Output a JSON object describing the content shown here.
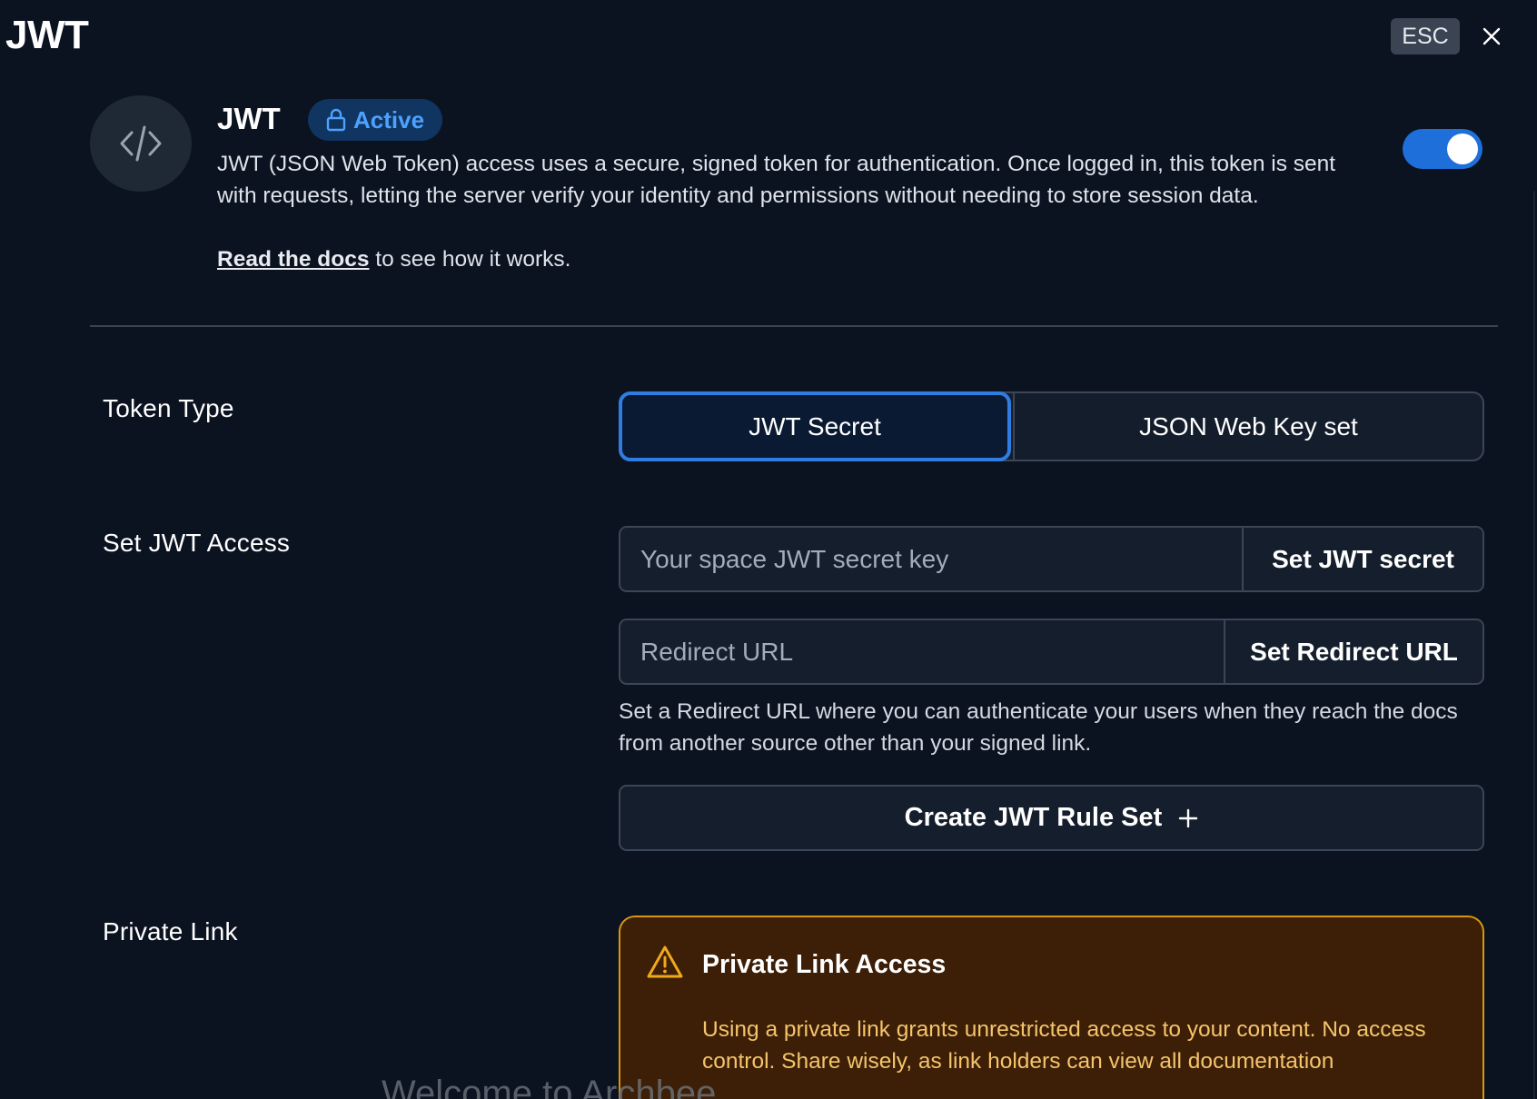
{
  "window": {
    "title": "JWT",
    "esc_label": "ESC"
  },
  "integration": {
    "name": "JWT",
    "status": "Active",
    "enabled": true,
    "description": "JWT (JSON Web Token) access uses a secure, signed token for authentication. Once logged in, this token is sent with requests, letting the server verify your identity and permissions without needing to store session data.",
    "docs_link": "Read the docs",
    "docs_suffix": " to see how it works.",
    "icon": "code-icon"
  },
  "token_type": {
    "label": "Token Type",
    "options": [
      "JWT Secret",
      "JSON Web Key set"
    ],
    "selected": "JWT Secret"
  },
  "jwt_access": {
    "label": "Set JWT Access",
    "secret_placeholder": "Your space JWT secret key",
    "secret_value": "",
    "secret_button": "Set JWT secret",
    "redirect_placeholder": "Redirect URL",
    "redirect_value": "",
    "redirect_button": "Set Redirect URL",
    "redirect_help": "Set a Redirect URL where you can authenticate your users when they reach the docs from another source other than your signed link.",
    "create_rule_button": "Create JWT Rule Set"
  },
  "private_link": {
    "label": "Private Link",
    "warning_title": "Private Link Access",
    "warning_body": "Using a private link grants unrestricted access to your content. No access control. Share wisely, as link holders can view all documentation"
  },
  "background": {
    "partial_text": "Welcome to Archbee"
  },
  "colors": {
    "background": "#0b1220",
    "accent": "#2f7de1",
    "status_text": "#4ea1ff",
    "warning_border": "#d9960f",
    "warning_text": "#f5c46b"
  }
}
